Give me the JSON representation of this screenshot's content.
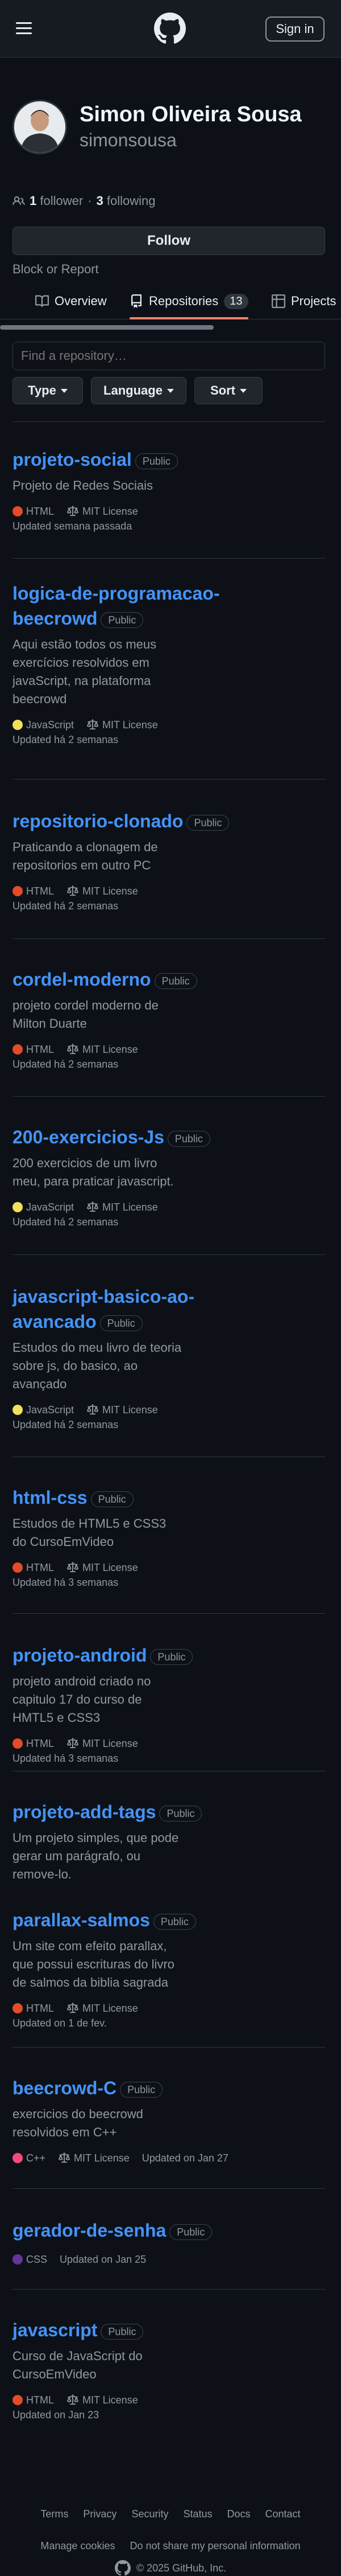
{
  "header": {
    "signin_label": "Sign in"
  },
  "profile": {
    "full_name": "Simon Oliveira Sousa",
    "login": "simonsousa",
    "followers_count": "1",
    "followers_label": "follower",
    "separator": "·",
    "following_count": "3",
    "following_label": "following",
    "follow_label": "Follow",
    "block_label": "Block or Report"
  },
  "tabs": [
    {
      "label": "Overview"
    },
    {
      "label": "Repositories",
      "count": "13"
    },
    {
      "label": "Projects"
    }
  ],
  "filters": {
    "search_placeholder": "Find a repository…",
    "type_label": "Type",
    "language_label": "Language",
    "sort_label": "Sort"
  },
  "lang_colors": {
    "HTML": "#e34c26",
    "JavaScript": "#f1e05a",
    "C++": "#f34b7d",
    "CSS": "#663399"
  },
  "repos": [
    {
      "name": "projeto-social",
      "visibility": "Public",
      "description": "Projeto de Redes Sociais",
      "language": "HTML",
      "license": "MIT License",
      "updated": "Updated semana passada"
    },
    {
      "name": "logica-de-programacao-beecrowd",
      "visibility": "Public",
      "description": "Aqui estão todos os meus exercícios resolvidos em javaScript, na plataforma beecrowd",
      "language": "JavaScript",
      "license": "MIT License",
      "updated": "Updated há 2 semanas"
    },
    {
      "name": "repositorio-clonado",
      "visibility": "Public",
      "description": "Praticando a clonagem de repositorios em outro PC",
      "language": "HTML",
      "license": "MIT License",
      "updated": "Updated há 2 semanas"
    },
    {
      "name": "cordel-moderno",
      "visibility": "Public",
      "description": "projeto cordel moderno de Milton Duarte",
      "language": "HTML",
      "license": "MIT License",
      "updated": "Updated há 2 semanas"
    },
    {
      "name": "200-exercicios-Js",
      "visibility": "Public",
      "description": "200 exercicios de um livro meu, para praticar javascript.",
      "language": "JavaScript",
      "license": "MIT License",
      "updated": "Updated há 2 semanas"
    },
    {
      "name": "javascript-basico-ao-avancado",
      "visibility": "Public",
      "description": "Estudos do meu livro de teoria sobre js, do basico, ao avançado",
      "language": "JavaScript",
      "license": "MIT License",
      "updated": "Updated há 2 semanas"
    },
    {
      "name": "html-css",
      "visibility": "Public",
      "description": "Estudos de HTML5 e CSS3 do CursoEmVideo",
      "language": "HTML",
      "license": "MIT License",
      "updated": "Updated há 3 semanas"
    },
    {
      "name": "projeto-android",
      "visibility": "Public",
      "description": "projeto android criado no capitulo 17 do curso de HMTL5 e CSS3",
      "language": "HTML",
      "license": "MIT License",
      "updated": "Updated há 3 semanas"
    },
    {
      "name": "projeto-add-tags",
      "visibility": "Public",
      "description": "Um projeto simples, que pode gerar um parágrafo, ou remove-lo."
    },
    {
      "name": "parallax-salmos",
      "visibility": "Public",
      "description": "Um site com efeito parallax, que possui escrituras do livro de salmos da biblia sagrada",
      "language": "HTML",
      "license": "MIT License",
      "updated": "Updated on 1 de fev."
    },
    {
      "name": "beecrowd-C",
      "visibility": "Public",
      "description": "exercicios do beecrowd resolvidos em C++",
      "language": "C++",
      "license": "MIT License",
      "updated": "Updated on Jan 27"
    },
    {
      "name": "gerador-de-senha",
      "visibility": "Public",
      "language": "CSS",
      "updated": "Updated on Jan 25"
    },
    {
      "name": "javascript",
      "visibility": "Public",
      "description": "Curso de JavaScript do CursoEmVideo",
      "language": "HTML",
      "license": "MIT License",
      "updated": "Updated on Jan 23"
    }
  ],
  "footer": {
    "links": [
      "Terms",
      "Privacy",
      "Security",
      "Status",
      "Docs",
      "Contact",
      "Manage cookies",
      "Do not share my personal information"
    ],
    "copyright": "© 2025 GitHub, Inc."
  }
}
